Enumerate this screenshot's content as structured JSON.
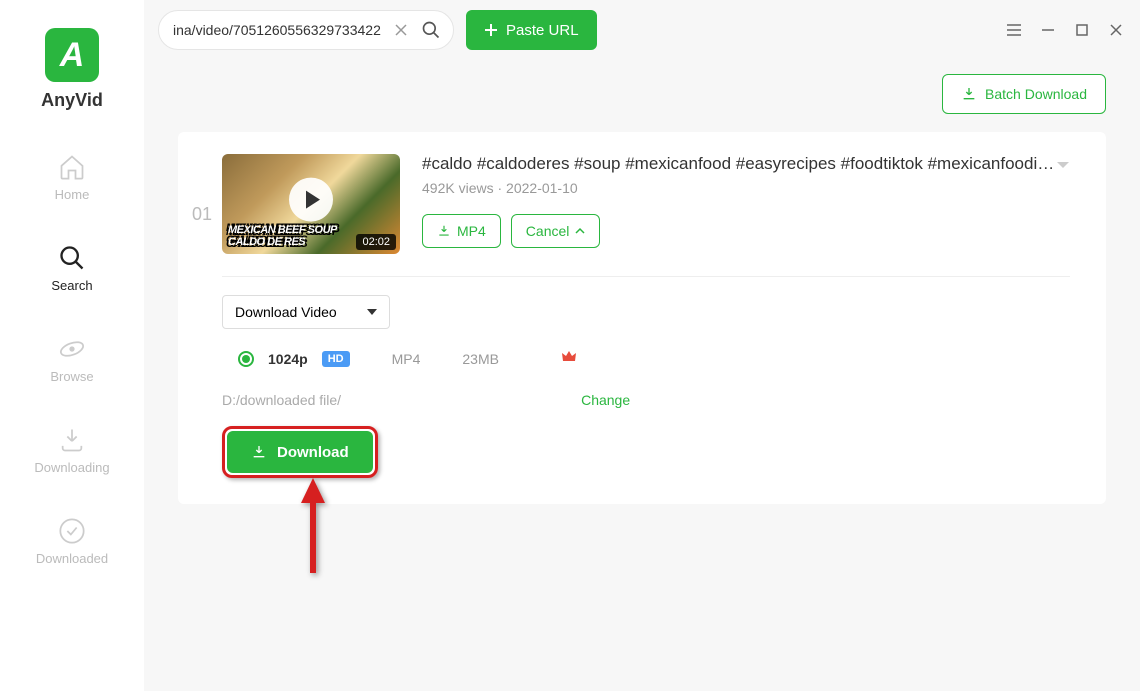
{
  "app": {
    "name": "AnyVid"
  },
  "nav": {
    "home": "Home",
    "search": "Search",
    "browse": "Browse",
    "downloading": "Downloading",
    "downloaded": "Downloaded"
  },
  "search": {
    "value": "ina/video/7051260556329733422"
  },
  "paste_label": "Paste URL",
  "batch_label": "Batch Download",
  "result": {
    "index": "01",
    "title": "#caldo #caldoderes #soup #mexicanfood #easyrecipes #foodtiktok #mexicanfoodie ...",
    "views": "492K views",
    "date": "2022-01-10",
    "duration": "02:02",
    "thumb_caption": "Mexican Beef Soup Caldo de Res",
    "mp4_btn": "MP4",
    "cancel_btn": "Cancel"
  },
  "options": {
    "dropdown_label": "Download Video",
    "quality": "1024p",
    "hd": "HD",
    "format": "MP4",
    "size": "23MB",
    "path": "D:/downloaded file/",
    "change": "Change",
    "download_btn": "Download"
  }
}
